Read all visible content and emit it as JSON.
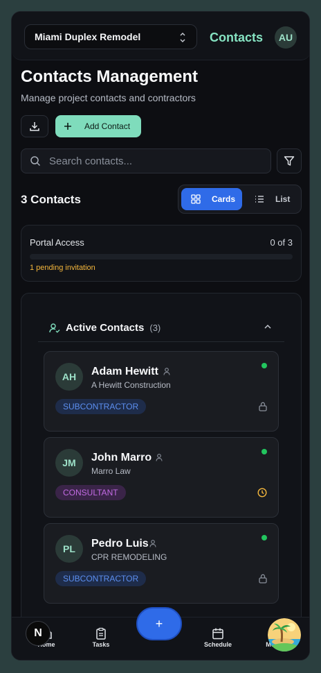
{
  "header": {
    "project": "Miami Duplex Remodel",
    "title": "Contacts",
    "user_initials": "AU"
  },
  "page": {
    "title": "Contacts Management",
    "subtitle": "Manage project contacts and contractors",
    "add_contact_label": "Add Contact",
    "search_placeholder": "Search contacts...",
    "contacts_count": "3 Contacts",
    "view_cards_label": "Cards",
    "view_list_label": "List"
  },
  "portal": {
    "label": "Portal Access",
    "value": "0 of 3",
    "progress_fraction": 0,
    "pending": "1 pending invitation"
  },
  "section": {
    "title": "Active Contacts",
    "count": "(3)"
  },
  "contacts": [
    {
      "initials": "AH",
      "name": "Adam Hewitt",
      "company": "A Hewitt Construction",
      "role": "SUBCONTRACTOR",
      "status_icon": "lock-icon"
    },
    {
      "initials": "JM",
      "name": "John Marro",
      "company": "Marro Law",
      "role": "CONSULTANT",
      "status_icon": "clock-icon"
    },
    {
      "initials": "PL",
      "name": "Pedro Luis",
      "company": "CPR REMODELING",
      "role": "SUBCONTRACTOR",
      "status_icon": "lock-icon"
    }
  ],
  "nav": {
    "home": "Home",
    "tasks": "Tasks",
    "fab": "+",
    "schedule": "Schedule",
    "more": "More",
    "n_badge": "N"
  },
  "colors": {
    "accent": "#7fdcbc",
    "primary": "#2f6be8",
    "online": "#22c55e",
    "pending": "#f5b73c"
  }
}
